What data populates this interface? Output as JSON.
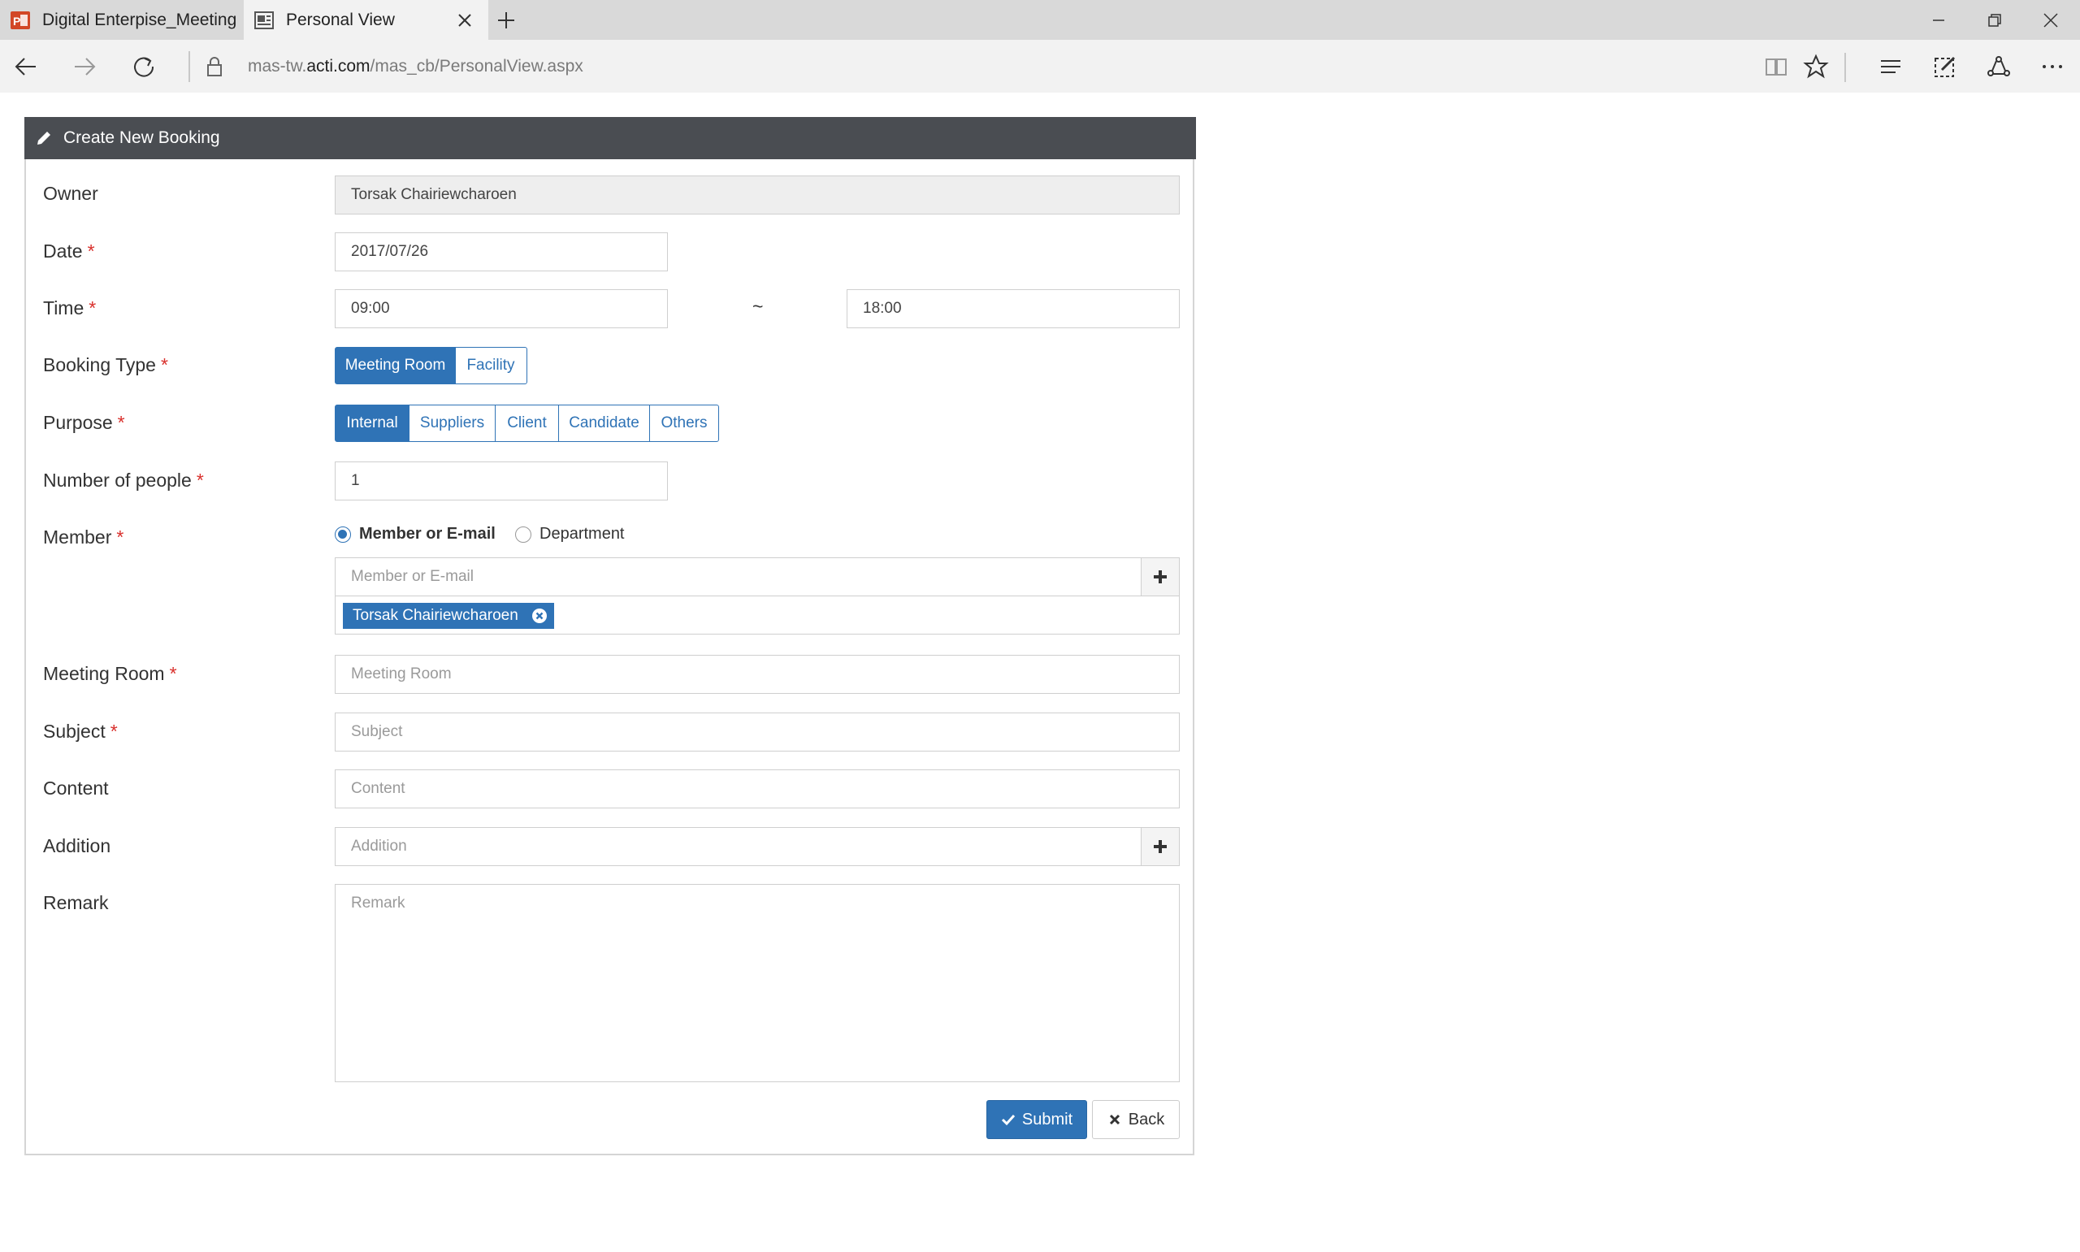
{
  "browser": {
    "tabs": [
      {
        "title": "Digital Enterpise_Meeting re",
        "icon": "powerpoint-icon",
        "active": false
      },
      {
        "title": "Personal View",
        "icon": "page-icon",
        "active": true
      }
    ],
    "url_prefix": "mas-tw.",
    "url_host": "acti.com",
    "url_path": "/mas_cb/PersonalView.aspx"
  },
  "panel": {
    "title": "Create New Booking",
    "icon": "pencil-icon"
  },
  "form": {
    "owner": {
      "label": "Owner",
      "value": "Torsak Chairiewcharoen"
    },
    "date": {
      "label": "Date",
      "value": "2017/07/26"
    },
    "time": {
      "label": "Time",
      "start": "09:00",
      "separator": "~",
      "end": "18:00"
    },
    "booking_type": {
      "label": "Booking Type",
      "options": [
        "Meeting Room",
        "Facility"
      ],
      "selected": "Meeting Room"
    },
    "purpose": {
      "label": "Purpose",
      "options": [
        "Internal",
        "Suppliers",
        "Client",
        "Candidate",
        "Others"
      ],
      "selected": "Internal"
    },
    "people": {
      "label": "Number of people",
      "value": "1"
    },
    "member": {
      "label": "Member",
      "radio_member": "Member or E-mail",
      "radio_department": "Department",
      "selected": "Member or E-mail",
      "placeholder": "Member or E-mail",
      "tags": [
        "Torsak Chairiewcharoen"
      ]
    },
    "meeting_room": {
      "label": "Meeting Room",
      "placeholder": "Meeting Room"
    },
    "subject": {
      "label": "Subject",
      "placeholder": "Subject"
    },
    "content": {
      "label": "Content",
      "placeholder": "Content"
    },
    "addition": {
      "label": "Addition",
      "placeholder": "Addition"
    },
    "remark": {
      "label": "Remark",
      "placeholder": "Remark"
    },
    "required_mark": "*"
  },
  "actions": {
    "submit": "Submit",
    "back": "Back"
  },
  "colors": {
    "primary": "#2f73b6",
    "header": "#4a4d52",
    "required": "#d9302c"
  }
}
